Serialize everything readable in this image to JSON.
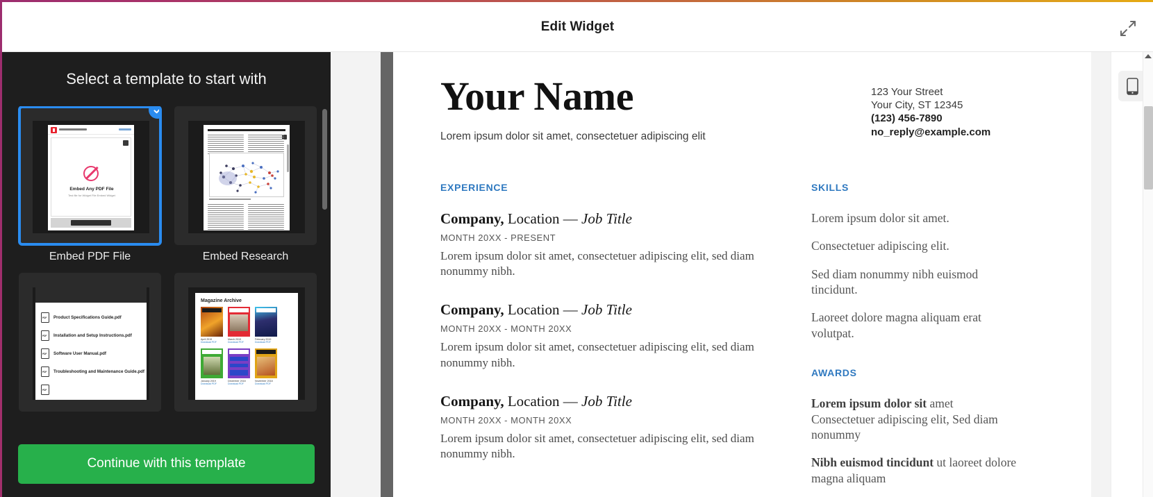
{
  "header": {
    "title": "Edit Widget",
    "expand_icon": "expand-arrows-icon"
  },
  "template_panel": {
    "title": "Select a template to start with",
    "cta_label": "Continue with this template",
    "selected_index": 0,
    "check_icon": "check-icon",
    "templates": [
      {
        "label": "Embed PDF File",
        "selected": true,
        "preview": {
          "kind": "pdf-viewer",
          "brand_color": "#e8232f",
          "heading": "Embed Any PDF File",
          "subheading": "Test file for Widget File Embed Widget"
        }
      },
      {
        "label": "Embed Research",
        "selected": false,
        "preview": {
          "kind": "research-paper"
        }
      },
      {
        "label": "",
        "selected": false,
        "preview": {
          "kind": "file-list",
          "files": [
            "Product Specifications Guide.pdf",
            "Installation and Setup Instructions.pdf",
            "Software User Manual.pdf",
            "Troubleshooting and Maintenance Guide.pdf"
          ]
        }
      },
      {
        "label": "",
        "selected": false,
        "preview": {
          "kind": "magazine-archive",
          "title": "Magazine Archive",
          "issues": [
            {
              "date": "April 2019",
              "link": "Download PDF",
              "color": "#8d3a12",
              "accent": "#f0a32a"
            },
            {
              "date": "March 2019",
              "link": "Download PDF",
              "color": "#e32b35",
              "accent": "#ffffff"
            },
            {
              "date": "February 2019",
              "link": "Download PDF",
              "color": "#2e2f6e",
              "accent": "#3ec6f0"
            },
            {
              "date": "January 2019",
              "link": "Download PDF",
              "color": "#3faa35",
              "accent": "#ffffff"
            },
            {
              "date": "December 2018",
              "link": "Download PDF",
              "color": "#7b3ec4",
              "accent": "#2b47c9"
            },
            {
              "date": "November 2018",
              "link": "Download PDF",
              "color": "#e0a417",
              "accent": "#b5521e"
            }
          ]
        }
      }
    ]
  },
  "preview": {
    "device_icon": "mobile-device-icon",
    "scroll_up_icon": "triangle-up-icon",
    "resume": {
      "name": "Your Name",
      "tagline": "Lorem ipsum dolor sit amet, consectetuer adipiscing elit",
      "contact": {
        "street": "123 Your Street",
        "city_state_zip": "Your City, ST 12345",
        "phone": "(123) 456-7890",
        "email": "no_reply@example.com"
      },
      "experience": {
        "heading": "EXPERIENCE",
        "jobs": [
          {
            "company": "Company,",
            "location": "Location",
            "dash": "—",
            "job_title": "Job Title",
            "dates": "MONTH 20XX - PRESENT",
            "description": "Lorem ipsum dolor sit amet, consectetuer adipiscing elit, sed diam nonummy nibh."
          },
          {
            "company": "Company,",
            "location": "Location",
            "dash": "—",
            "job_title": "Job Title",
            "dates": "MONTH 20XX - MONTH 20XX",
            "description": "Lorem ipsum dolor sit amet, consectetuer adipiscing elit, sed diam nonummy nibh."
          },
          {
            "company": "Company,",
            "location": "Location",
            "dash": "—",
            "job_title": "Job Title",
            "dates": "MONTH 20XX - MONTH 20XX",
            "description": "Lorem ipsum dolor sit amet, consectetuer adipiscing elit, sed diam nonummy nibh."
          }
        ]
      },
      "skills": {
        "heading": "SKILLS",
        "items": [
          "Lorem ipsum dolor sit amet.",
          "Consectetuer adipiscing elit.",
          "Sed diam nonummy nibh euismod tincidunt.",
          "Laoreet dolore magna aliquam erat volutpat."
        ]
      },
      "awards": {
        "heading": "AWARDS",
        "items": [
          {
            "bold": "Lorem ipsum dolor sit",
            "rest": " amet Consectetuer adipiscing elit, Sed diam nonummy"
          },
          {
            "bold": "Nibh euismod tincidunt",
            "rest": " ut laoreet dolore magna aliquam"
          }
        ]
      }
    }
  },
  "colors": {
    "accent_blue": "#2f79c0",
    "select_blue": "#2a8cf0",
    "cta_green": "#27b04b",
    "panel_dark": "#1e1e1e"
  }
}
